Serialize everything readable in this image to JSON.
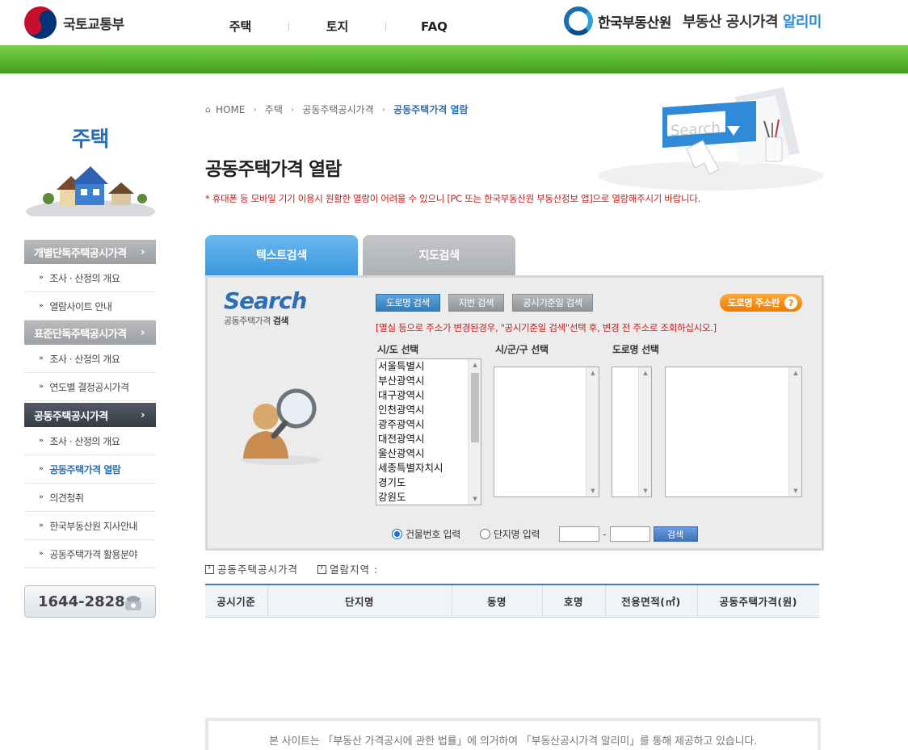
{
  "header": {
    "molit_name": "국토교통부",
    "nav": [
      "주택",
      "토지",
      "FAQ"
    ],
    "reb_name": "한국부동산원",
    "site_title_pre": "부동산 공시가격",
    "site_title_hl": "알리미"
  },
  "sidebar": {
    "title": "주택",
    "groups": [
      {
        "label": "개별단독주택공시가격",
        "active": false,
        "items": [
          "조사 · 산정의 개요",
          "열람사이트 안내"
        ]
      },
      {
        "label": "표준단독주택공시가격",
        "active": false,
        "items": [
          "조사 · 산정의 개요",
          "연도별 결정공시가격"
        ]
      },
      {
        "label": "공동주택공시가격",
        "active": true,
        "items": [
          "조사 · 산정의 개요",
          "공동주택가격 열람",
          "의견청취",
          "한국부동산원 지사안내",
          "공동주택가격 활용분야"
        ]
      }
    ],
    "phone": "1644-2828"
  },
  "breadcrumb": [
    "HOME",
    "주택",
    "공동주택공시가격",
    "공동주택가격 열람"
  ],
  "page_title": "공동주택가격 열람",
  "notice": "* 휴대폰 등 모바일 기기 이용시 원활한 열람이 어려울 수 있으니 [PC 또는 한국부동산원 부동산정보 앱]으로 열람해주시기 바랍니다.",
  "hero_search_text": "Search",
  "tabs": [
    "텍스트검색",
    "지도검색"
  ],
  "search": {
    "logo_big": "Search",
    "logo_small_pre": "공동주택가격",
    "logo_small_bold": "검색",
    "buttons": [
      "도로명 검색",
      "지번 검색",
      "공시기준일 검색"
    ],
    "road_help": "도로명 주소란",
    "road_help_q": "?",
    "note": "[멸실 등으로 주소가 변경된경우, \"공시기준일 검색\"선택 후, 변경 전 주소로 조회하십시오.]",
    "labels": [
      "시/도 선택",
      "시/군/구 선택",
      "도로명 선택"
    ],
    "sido_options": [
      "서울특별시",
      "부산광역시",
      "대구광역시",
      "인천광역시",
      "광주광역시",
      "대전광역시",
      "울산광역시",
      "세종특별자치시",
      "경기도",
      "강원도"
    ],
    "radio1": "건물번호 입력",
    "radio2": "단지명 입력",
    "go": "검색",
    "dash": "-"
  },
  "info": {
    "item1": "공동주택공시가격",
    "item2": "열람지역 :"
  },
  "table_headers": [
    "공시기준",
    "단지명",
    "동명",
    "호명",
    "전용면적(㎡)",
    "공동주택가격(원)"
  ],
  "footer": "본 사이트는 「부동산 가격공시에 관한 법률」에 의거하여 「부동산공시가격 알리미」를 통해 제공하고 있습니다."
}
